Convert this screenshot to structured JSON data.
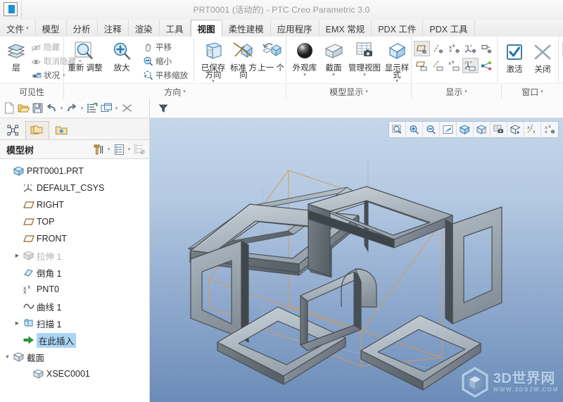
{
  "window": {
    "title": "PRT0001 (活动的) - PTC Creo Parametric 3.0",
    "app_icon": "creo-app-icon"
  },
  "tabs": [
    {
      "label": "文件",
      "caret": "▾",
      "active": false,
      "name": "tab-file"
    },
    {
      "label": "模型",
      "active": false,
      "name": "tab-model"
    },
    {
      "label": "分析",
      "active": false,
      "name": "tab-analysis"
    },
    {
      "label": "注释",
      "active": false,
      "name": "tab-annotate"
    },
    {
      "label": "渲染",
      "active": false,
      "name": "tab-render"
    },
    {
      "label": "工具",
      "active": false,
      "name": "tab-tools"
    },
    {
      "label": "视图",
      "active": true,
      "name": "tab-view"
    },
    {
      "label": "柔性建模",
      "active": false,
      "name": "tab-flexible-modeling"
    },
    {
      "label": "应用程序",
      "active": false,
      "name": "tab-applications"
    },
    {
      "label": "EMX 常规",
      "active": false,
      "name": "tab-emx-general"
    },
    {
      "label": "PDX 工件",
      "active": false,
      "name": "tab-pdx-part"
    },
    {
      "label": "PDX 工具",
      "active": false,
      "name": "tab-pdx-tools"
    }
  ],
  "ribbon": {
    "groups": [
      {
        "name": "visibility",
        "label": "可见性",
        "caret": "",
        "big": [
          {
            "label": "层",
            "icon": "layers-icon",
            "caret": ""
          }
        ],
        "small": [
          {
            "label": "隐藏",
            "icon": "hide-icon",
            "dim": true,
            "caret": ""
          },
          {
            "label": "取消隐藏",
            "icon": "unhide-icon",
            "dim": true,
            "caret": "▾"
          },
          {
            "label": "状况",
            "icon": "status-icon",
            "dim": false,
            "caret": "▾"
          }
        ]
      },
      {
        "name": "orientation",
        "label": "方向",
        "caret": "▾",
        "big": [
          {
            "label": "重新\n调整",
            "icon": "refit-icon",
            "caret": ""
          },
          {
            "label": "放大",
            "icon": "zoom-in-icon",
            "caret": ""
          }
        ],
        "small": [
          {
            "label": "平移",
            "icon": "pan-icon",
            "dim": false,
            "caret": ""
          },
          {
            "label": "缩小",
            "icon": "zoom-out-icon",
            "dim": false,
            "caret": ""
          },
          {
            "label": "平移缩放",
            "icon": "pan-zoom-icon",
            "dim": false,
            "caret": ""
          }
        ],
        "big2": [
          {
            "label": "已保存\n方向",
            "icon": "saved-orientation-icon",
            "caret": "▾"
          },
          {
            "label": "标准\n方向",
            "icon": "standard-orientation-icon",
            "caret": ""
          },
          {
            "label": "上一\n个",
            "icon": "previous-view-icon",
            "caret": ""
          }
        ]
      },
      {
        "name": "model-display",
        "label": "模型显示",
        "caret": "▾",
        "big": [
          {
            "label": "外观库",
            "icon": "appearance-gallery-icon",
            "caret": "▾"
          },
          {
            "label": "截面",
            "icon": "section-icon",
            "caret": "▾"
          },
          {
            "label": "管理视图",
            "icon": "manage-views-icon",
            "caret": "▾"
          },
          {
            "label": "显示样\n式",
            "icon": "display-style-icon",
            "caret": "▾"
          }
        ]
      },
      {
        "name": "display",
        "label": "显示",
        "caret": "▾",
        "grid_top": [
          {
            "icon": "plane-display-icon",
            "selected": true
          },
          {
            "icon": "axis-display-icon",
            "selected": false
          },
          {
            "icon": "point-display-icon",
            "selected": false
          },
          {
            "icon": "csys-display-icon",
            "selected": false
          },
          {
            "icon": "annotation-display-icon",
            "selected": false
          }
        ],
        "grid_bottom": [
          {
            "icon": "plane-tag-icon",
            "selected": false
          },
          {
            "icon": "axis-tag-icon",
            "selected": false
          },
          {
            "icon": "point-tag-icon",
            "selected": false
          },
          {
            "icon": "csys-tag-icon",
            "selected": true
          },
          {
            "icon": "spin-center-icon",
            "selected": false
          }
        ]
      },
      {
        "name": "window",
        "label": "窗口",
        "caret": "▾",
        "big": [
          {
            "label": "激活",
            "icon": "activate-check-icon",
            "caret": ""
          },
          {
            "label": "关闭",
            "icon": "close-x-icon",
            "caret": ""
          }
        ],
        "clipped_label": "窗"
      }
    ]
  },
  "quick_access": {
    "buttons": [
      {
        "icon": "new-file-icon",
        "name": "new-button"
      },
      {
        "icon": "open-folder-icon",
        "name": "open-button"
      },
      {
        "icon": "save-disk-icon",
        "name": "save-button"
      },
      {
        "icon": "undo-arrow-icon",
        "name": "undo-button"
      },
      {
        "icon": "caret-down-icon",
        "name": "undo-dropdown"
      },
      {
        "icon": "redo-arrow-icon",
        "name": "redo-button"
      },
      {
        "icon": "caret-down-icon",
        "name": "redo-dropdown"
      },
      {
        "icon": "regenerate-icon",
        "name": "regenerate-button"
      },
      {
        "icon": "window-switch-icon",
        "name": "window-switch-button"
      },
      {
        "icon": "caret-down-icon",
        "name": "window-dropdown"
      },
      {
        "icon": "close-window-icon",
        "name": "close-window-button"
      }
    ]
  },
  "navigator": {
    "tabs": [
      {
        "icon": "model-tree-icon",
        "active": false,
        "name": "nav-tab-model-tree"
      },
      {
        "icon": "folder-browser-icon",
        "active": true,
        "name": "nav-tab-folder-browser"
      },
      {
        "icon": "favorites-icon",
        "active": false,
        "name": "nav-tab-favorites"
      }
    ]
  },
  "model_tree": {
    "title": "模型树",
    "header_tools": [
      {
        "icon": "settings-hammer-icon",
        "name": "tree-settings-button"
      },
      {
        "icon": "caret-down-icon",
        "name": "tree-settings-dropdown"
      },
      {
        "icon": "tree-columns-icon",
        "name": "tree-columns-button"
      },
      {
        "icon": "caret-down-icon",
        "name": "tree-columns-dropdown"
      },
      {
        "icon": "tree-filter-icon",
        "name": "tree-filter-button"
      }
    ],
    "nodes": [
      {
        "label": "PRT0001.PRT",
        "icon": "part-icon",
        "indent": 0,
        "arrow": "",
        "dim": false,
        "highlight": false
      },
      {
        "label": "DEFAULT_CSYS",
        "icon": "csys-icon",
        "indent": 1,
        "arrow": "",
        "dim": false,
        "highlight": false
      },
      {
        "label": "RIGHT",
        "icon": "datum-plane-icon",
        "indent": 1,
        "arrow": "",
        "dim": false,
        "highlight": false
      },
      {
        "label": "TOP",
        "icon": "datum-plane-icon",
        "indent": 1,
        "arrow": "",
        "dim": false,
        "highlight": false
      },
      {
        "label": "FRONT",
        "icon": "datum-plane-icon",
        "indent": 1,
        "arrow": "",
        "dim": false,
        "highlight": false
      },
      {
        "label": "拉伸 1",
        "icon": "extrude-icon",
        "indent": 1,
        "arrow": "▶",
        "dim": true,
        "highlight": false
      },
      {
        "label": "倒角 1",
        "icon": "chamfer-icon",
        "indent": 1,
        "arrow": "",
        "dim": false,
        "highlight": false
      },
      {
        "label": "PNT0",
        "icon": "point-icon",
        "indent": 1,
        "arrow": "",
        "dim": false,
        "highlight": false
      },
      {
        "label": "曲线 1",
        "icon": "curve-icon",
        "indent": 1,
        "arrow": "",
        "dim": false,
        "highlight": false
      },
      {
        "label": "扫描 1",
        "icon": "sweep-icon",
        "indent": 1,
        "arrow": "▶",
        "dim": false,
        "highlight": false
      },
      {
        "label": "在此插入",
        "icon": "insert-here-icon",
        "indent": 1,
        "arrow": "",
        "dim": false,
        "highlight": true
      },
      {
        "label": "截面",
        "icon": "section-folder-icon",
        "indent": 0,
        "arrow": "▼",
        "dim": false,
        "highlight": false
      },
      {
        "label": "XSEC0001",
        "icon": "xsec-icon",
        "indent": 2,
        "arrow": "",
        "dim": false,
        "highlight": false
      }
    ]
  },
  "viewport": {
    "filter_icon": "filter-funnel-icon",
    "toolbar": [
      {
        "icon": "refit-zoom-icon",
        "name": "vp-refit-button"
      },
      {
        "icon": "zoom-in-icon",
        "name": "vp-zoom-in-button"
      },
      {
        "icon": "zoom-out-icon",
        "name": "vp-zoom-out-button"
      },
      {
        "icon": "repaint-icon",
        "name": "vp-repaint-button"
      },
      {
        "icon": "saved-view-cube-icon",
        "name": "vp-saved-orientation-button"
      },
      {
        "icon": "view-manager-icon",
        "name": "vp-view-manager-button"
      },
      {
        "icon": "appearance-camera-icon",
        "name": "vp-appearance-button"
      },
      {
        "icon": "display-style-cube-icon",
        "name": "vp-display-style-button"
      },
      {
        "icon": "datum-display-icon",
        "name": "vp-datum-display-button"
      },
      {
        "icon": "annotation-display-icon",
        "name": "vp-annotation-display-button"
      }
    ],
    "watermark": {
      "title": "3D世界网",
      "url": "WWW.3DSJW.COM",
      "logo": "hex-cube-logo"
    },
    "model": {
      "name": "cube-frame-lattice",
      "description": "六面方环镂空立方体 (sweep of square loops)"
    }
  },
  "colors": {
    "accent_blue": "#1a8fd4",
    "tree_highlight": "#aad6f5",
    "viewport_top": "#c4d6ea",
    "viewport_bottom": "#6b8cb8",
    "datum_orange": "#d99a4e",
    "model_light": "#b9c2c9",
    "model_dark": "#4a5056"
  }
}
